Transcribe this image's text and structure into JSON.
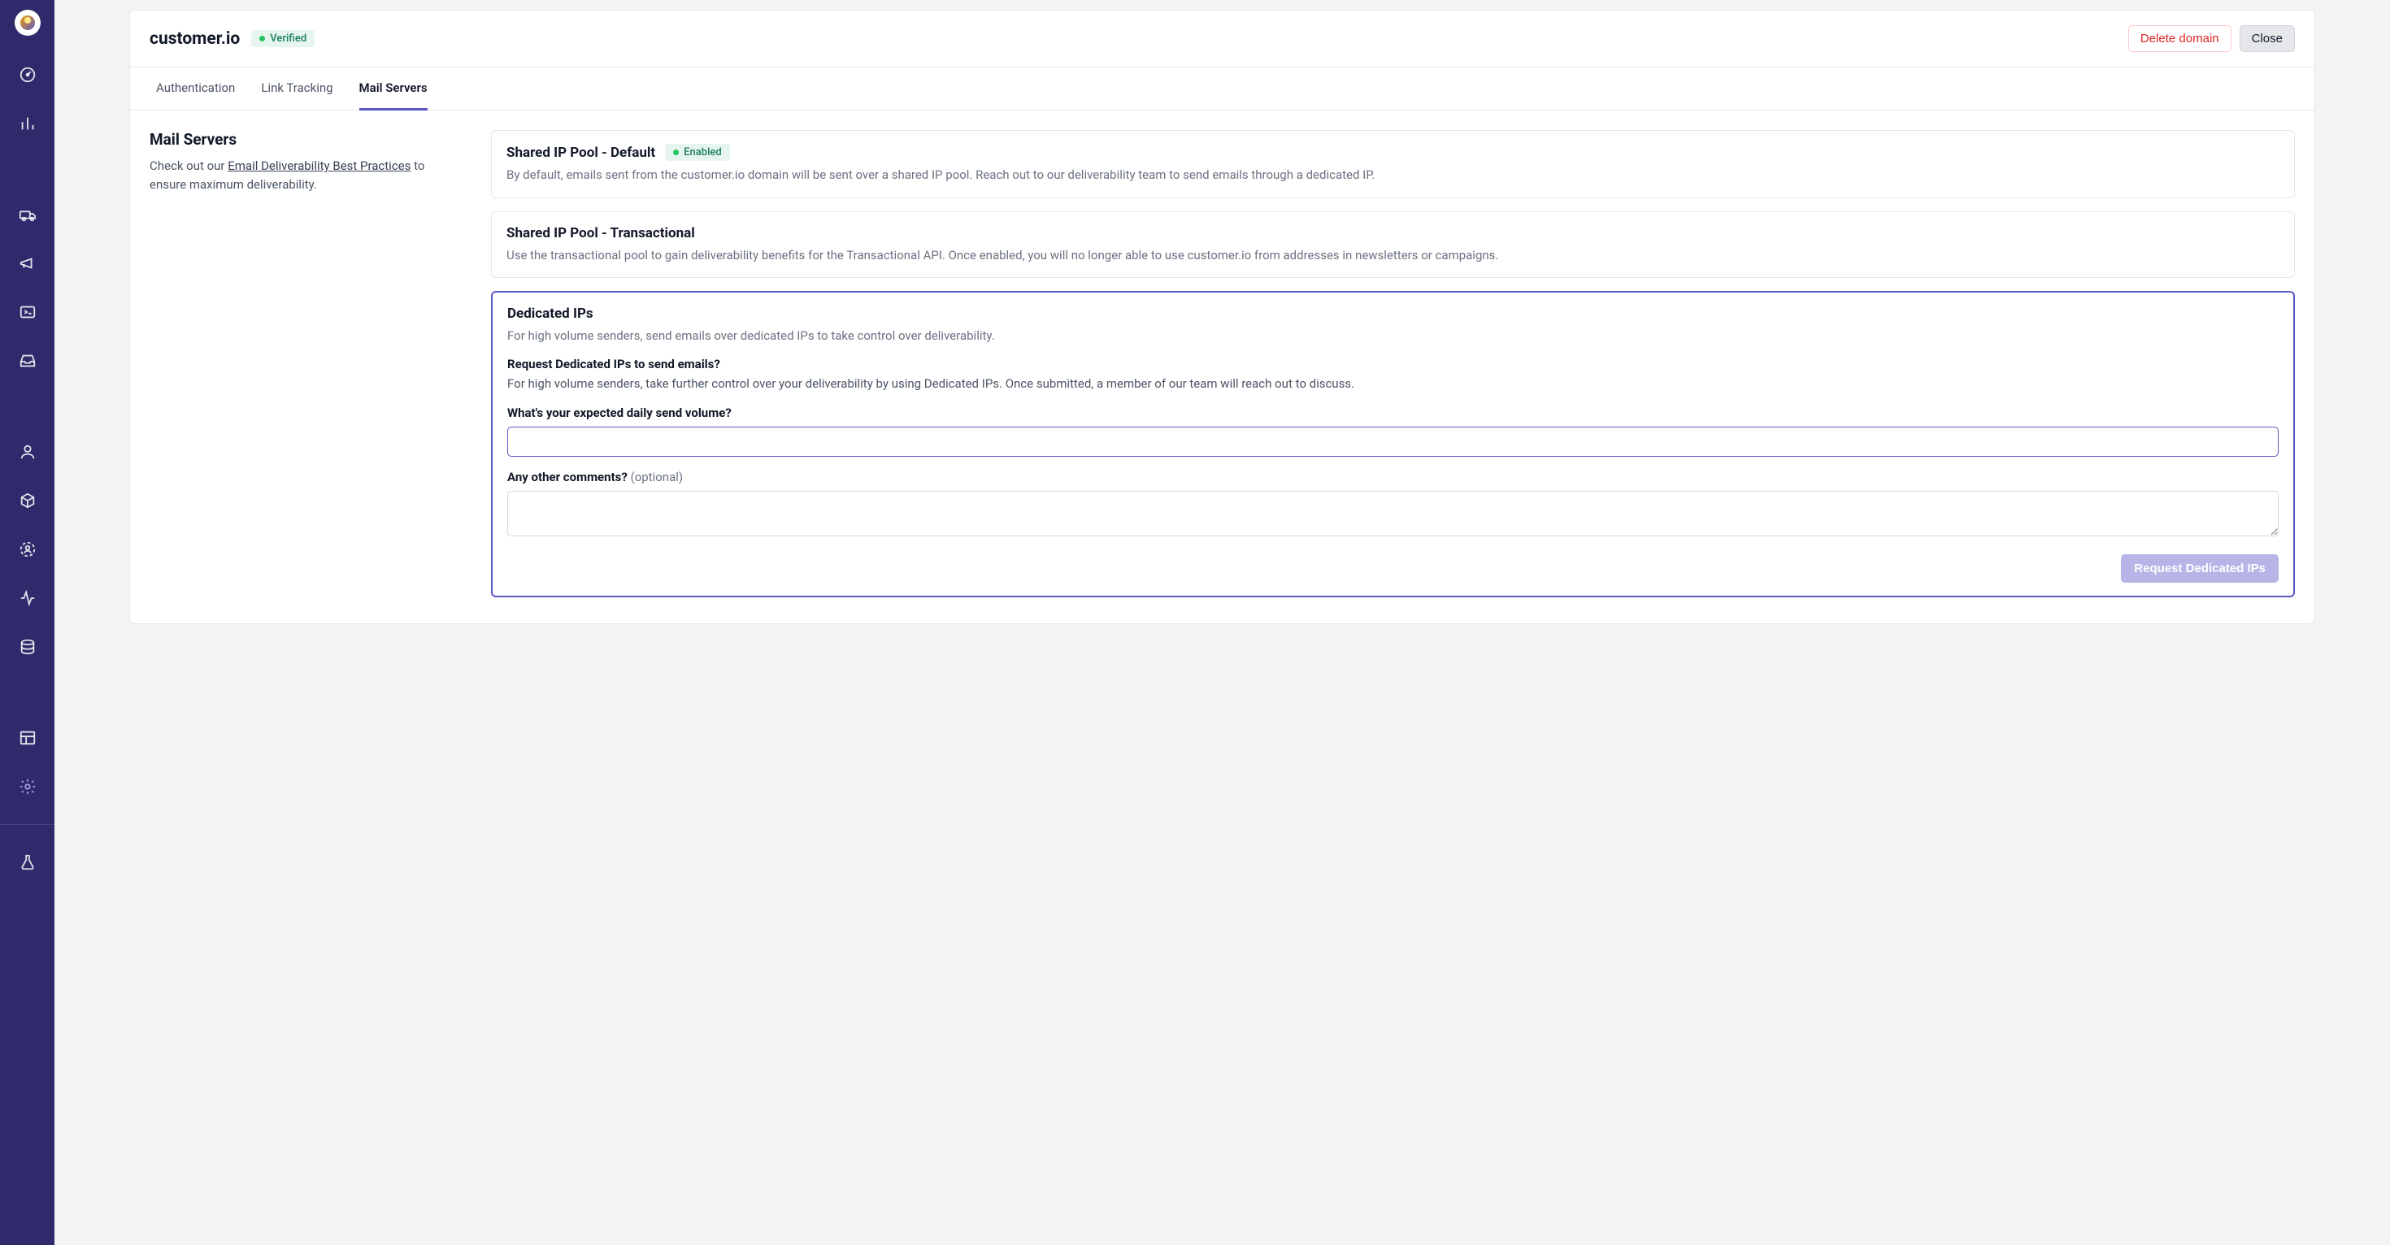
{
  "header": {
    "domain": "customer.io",
    "badge": "Verified",
    "delete_label": "Delete domain",
    "close_label": "Close"
  },
  "tabs": {
    "authentication": "Authentication",
    "link_tracking": "Link Tracking",
    "mail_servers": "Mail Servers"
  },
  "left": {
    "title": "Mail Servers",
    "desc_prefix": "Check out our ",
    "desc_link": "Email Deliverability Best Practices",
    "desc_suffix": " to ensure maximum deliverability."
  },
  "cards": {
    "shared_default": {
      "title": "Shared IP Pool - Default",
      "badge": "Enabled",
      "desc": "By default, emails sent from the customer.io domain will be sent over a shared IP pool. Reach out to our deliverability team to send emails through a dedicated IP."
    },
    "shared_transactional": {
      "title": "Shared IP Pool - Transactional",
      "desc": "Use the transactional pool to gain deliverability benefits for the Transactional API. Once enabled, you will no longer able to use customer.io from addresses in newsletters or campaigns."
    },
    "dedicated": {
      "title": "Dedicated IPs",
      "desc": "For high volume senders, send emails over dedicated IPs to take control over deliverability.",
      "form_heading": "Request Dedicated IPs to send emails?",
      "form_sub": "For high volume senders, take further control over your deliverability by using Dedicated IPs. Once submitted, a member of our team will reach out to discuss.",
      "volume_label": "What's your expected daily send volume?",
      "volume_value": "",
      "comments_label": "Any other comments?",
      "comments_optional": "(optional)",
      "comments_value": "",
      "submit_label": "Request Dedicated IPs"
    }
  }
}
